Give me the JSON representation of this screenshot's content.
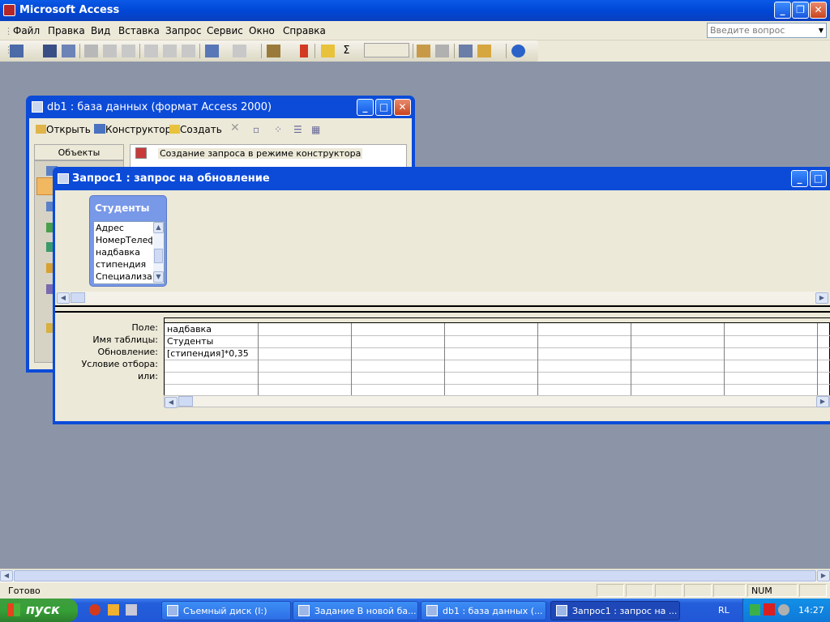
{
  "app": {
    "title": "Microsoft Access"
  },
  "menu": {
    "items": [
      "Файл",
      "Правка",
      "Вид",
      "Вставка",
      "Запрос",
      "Сервис",
      "Окно",
      "Справка"
    ],
    "ask_placeholder": "Введите вопрос"
  },
  "db_window": {
    "title": "db1 : база данных (формат Access 2000)",
    "open_label": "Открыть",
    "design_label": "Конструктор",
    "create_label": "Создать",
    "objects_label": "Объекты",
    "list_item": "Создание запроса в режиме конструктора"
  },
  "query_window": {
    "title": "Запрос1 : запрос на обновление",
    "table_name": "Студенты",
    "fields": [
      "Адрес",
      "НомерТелефона",
      "надбавка",
      "стипендия",
      "Специализация"
    ],
    "row_labels": [
      "Поле:",
      "Имя таблицы:",
      "Обновление:",
      "Условие отбора:",
      "или:"
    ],
    "column1": {
      "field": "надбавка",
      "table": "Студенты",
      "update": "[стипендия]*0,35"
    }
  },
  "status": {
    "text": "Готово",
    "num": "NUM"
  },
  "taskbar": {
    "start": "пуск",
    "tasks": [
      "Съемный диск (I:)",
      "Задание  В новой ба...",
      "db1 : база данных (...",
      "Запрос1 : запрос на ..."
    ],
    "lang": "RL",
    "time": "14:27"
  }
}
